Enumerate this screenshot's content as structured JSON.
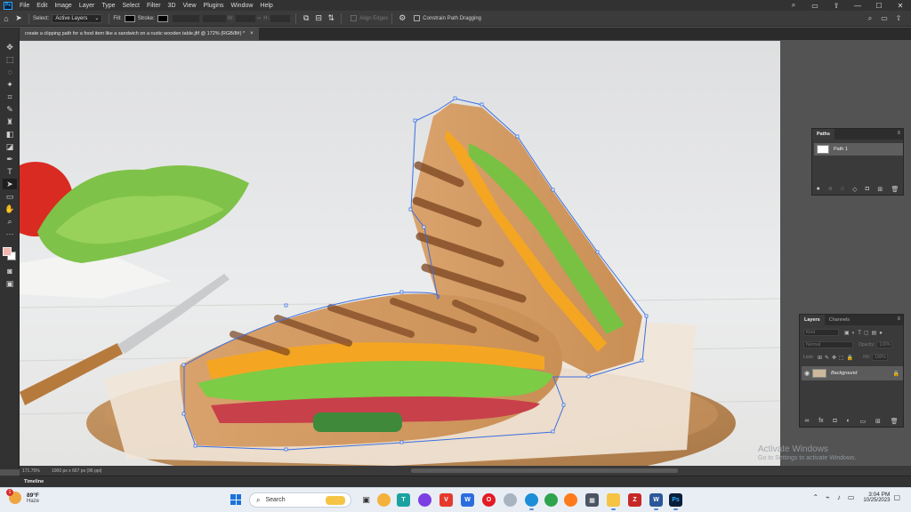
{
  "app": {
    "logo": "Ps",
    "name": "Adobe Photoshop"
  },
  "menu": [
    "File",
    "Edit",
    "Image",
    "Layer",
    "Type",
    "Select",
    "Filter",
    "3D",
    "View",
    "Plugins",
    "Window",
    "Help"
  ],
  "window_controls": {
    "minimize": "—",
    "maximize": "☐",
    "close": "✕"
  },
  "options_bar": {
    "select_label": "Select:",
    "select_value": "Active Layers",
    "fill_label": "Fill:",
    "stroke_label": "Stroke:",
    "w_label": "W:",
    "h_label": "H:",
    "align_edges": "Align Edges",
    "constrain": "Constrain Path Dragging"
  },
  "document_tab": {
    "title": "create a clipping path for a food item like a sandwich on a rustic wooden table.jfif @ 172% (RGB/8#) *",
    "close": "×"
  },
  "paths_panel": {
    "tab": "Paths",
    "items": [
      {
        "name": "Path 1"
      }
    ]
  },
  "layers_panel": {
    "tabs": [
      "Layers",
      "Channels"
    ],
    "kind_label": "Kind",
    "blend_mode": "Normal",
    "opacity_label": "Opacity:",
    "opacity_value": "100%",
    "lock_label": "Lock:",
    "fill_label": "Fill:",
    "fill_value": "100%",
    "layers": [
      {
        "name": "Background",
        "locked": true
      }
    ]
  },
  "status_bar": {
    "zoom": "171.75%",
    "info": "1000 px x 667 px (96 ppi)"
  },
  "timeline": {
    "label": "Timeline"
  },
  "watermark": {
    "title": "Activate Windows",
    "subtitle": "Go to Settings to activate Windows."
  },
  "taskbar": {
    "weather": {
      "temp": "89°F",
      "condition": "Haze",
      "badge": "1"
    },
    "search_placeholder": "Search",
    "clock": {
      "time": "3:04 PM",
      "date": "10/25/2023"
    }
  },
  "colors": {
    "accent": "#31a8ff",
    "foreground_swatch": "#f3b6b0",
    "path_anchor": "#3b6fe0"
  }
}
